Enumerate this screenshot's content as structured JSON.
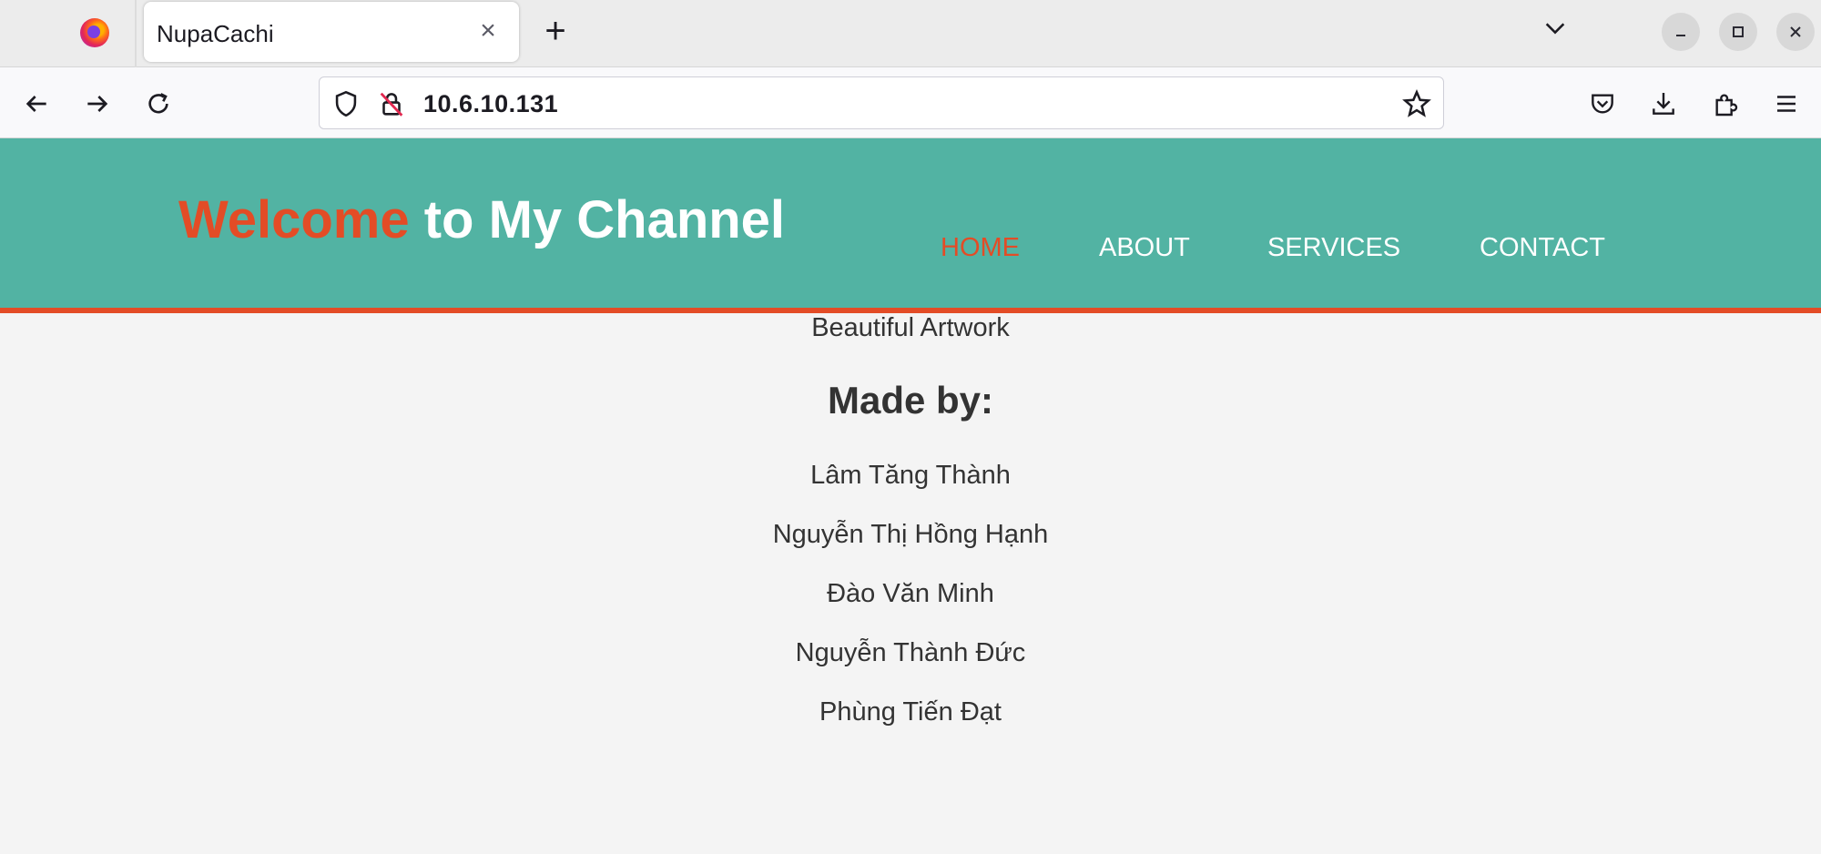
{
  "browser": {
    "tab_title": "NupaCachi",
    "tab_close": "×",
    "new_tab": "+",
    "url": "10.6.10.131",
    "icons": [
      "firefox-logo",
      "close-icon",
      "plus-icon",
      "chevron-down-icon",
      "minimize-icon",
      "maximize-icon",
      "window-close-icon",
      "back-arrow-icon",
      "forward-arrow-icon",
      "reload-icon",
      "shield-icon",
      "insecure-lock-icon",
      "star-icon",
      "pocket-icon",
      "download-icon",
      "extensions-icon",
      "menu-icon"
    ]
  },
  "site": {
    "title_accent": "Welcome",
    "title_rest": " to My Channel",
    "nav": [
      {
        "label": "HOME",
        "active": true
      },
      {
        "label": "ABOUT",
        "active": false
      },
      {
        "label": "SERVICES",
        "active": false
      },
      {
        "label": "CONTACT",
        "active": false
      }
    ],
    "accent_color": "#e34c26",
    "header_color": "#52b3a3"
  },
  "content": {
    "artwork": "Beautiful Artwork",
    "made_by": "Made by:",
    "members": [
      "Lâm Tăng Thành",
      "Nguyễn Thị Hồng Hạnh",
      "Đào Văn Minh",
      "Nguyễn Thành Đức",
      "Phùng Tiến Đạt"
    ]
  }
}
